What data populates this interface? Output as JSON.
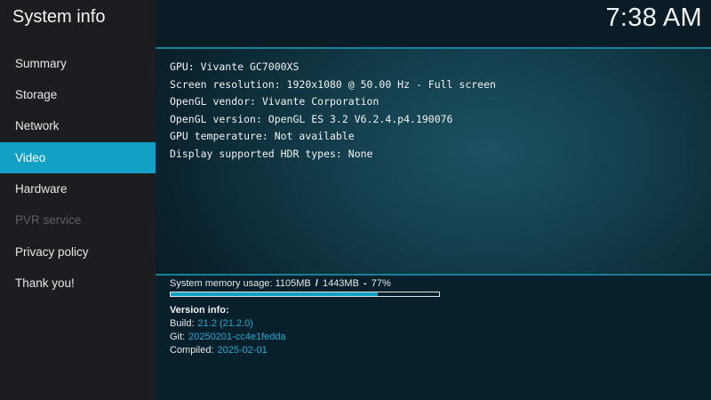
{
  "app": {
    "title": "System info",
    "clock": "7:38 AM"
  },
  "sidebar": {
    "items": [
      {
        "label": "Summary",
        "state": "normal"
      },
      {
        "label": "Storage",
        "state": "normal"
      },
      {
        "label": "Network",
        "state": "normal"
      },
      {
        "label": "Video",
        "state": "active"
      },
      {
        "label": "Hardware",
        "state": "normal"
      },
      {
        "label": "PVR service",
        "state": "disabled"
      },
      {
        "label": "Privacy policy",
        "state": "normal"
      },
      {
        "label": "Thank you!",
        "state": "normal"
      }
    ]
  },
  "info": {
    "lines": [
      "GPU: Vivante GC7000XS",
      "Screen resolution: 1920x1080 @ 50.00 Hz - Full screen",
      "OpenGL vendor: Vivante Corporation",
      "OpenGL version: OpenGL ES 3.2 V6.2.4.p4.190076",
      "GPU temperature: Not available",
      "Display supported HDR types: None"
    ]
  },
  "memory": {
    "label": "System memory usage:",
    "used": "1105MB",
    "separator": "/",
    "total": "1443MB",
    "dash": "-",
    "percent_text": "77%",
    "usage_fraction": 0.77
  },
  "version": {
    "heading": "Version info:",
    "build_key": "Build:",
    "build_value": "21.2 (21.2.0)",
    "git_key": "Git:",
    "git_value": "20250201-cc4e1fedda",
    "compiled_key": "Compiled:",
    "compiled_value": "2025-02-01"
  },
  "colors": {
    "accent": "#12a0c5",
    "sidebar_bg": "#1b1d21",
    "value_text": "#2aa9d2"
  }
}
